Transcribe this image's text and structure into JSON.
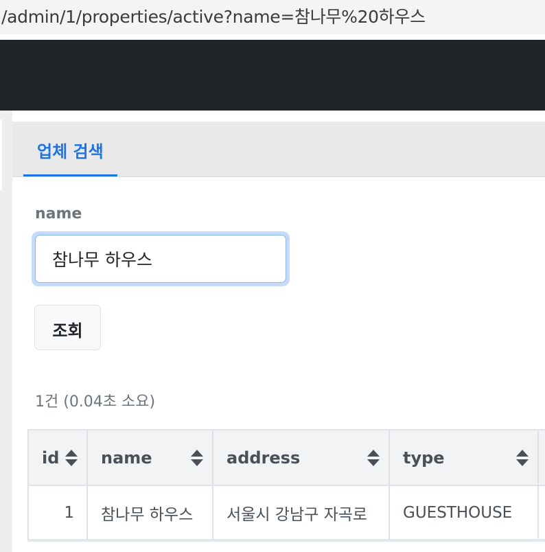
{
  "browser": {
    "url": "/admin/1/properties/active?name=참나무%20하우스"
  },
  "tabs": [
    {
      "label": "업체 검색"
    }
  ],
  "form": {
    "name_label": "name",
    "name_value": "참나무 하우스",
    "submit_label": "조회"
  },
  "result": {
    "summary": "1건 (0.04초 소요)"
  },
  "table": {
    "columns": [
      "id",
      "name",
      "address",
      "type"
    ],
    "rows": [
      {
        "id": "1",
        "name": "참나무 하우스",
        "address": "서울시 강남구 자곡로",
        "type": "GUESTHOUSE"
      }
    ]
  },
  "colors": {
    "accent": "#1a73e8",
    "navbar": "#212529",
    "focus_ring": "#c6dafc"
  }
}
